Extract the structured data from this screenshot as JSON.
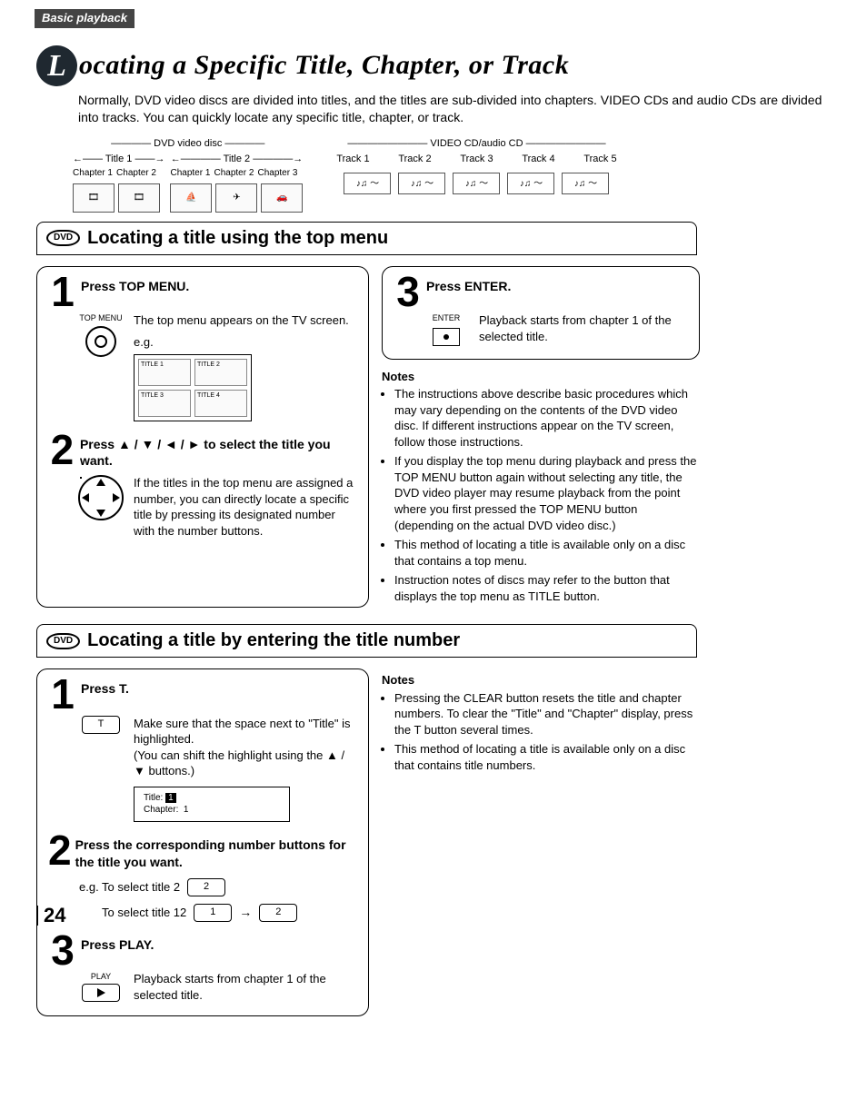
{
  "breadcrumb": "Basic playback",
  "page_number": "24",
  "main_title_prefix": "L",
  "main_title_rest": "ocating a Specific Title, Chapter, or Track",
  "intro": "Normally, DVD video discs are divided into titles, and the titles are sub-divided into chapters. VIDEO CDs and audio CDs are divided into tracks. You can quickly locate any specific title, chapter, or track.",
  "dvd_diagram": {
    "top": "DVD video disc",
    "titles": [
      "Title 1",
      "Title 2"
    ],
    "chapters_t1": [
      "Chapter 1",
      "Chapter 2"
    ],
    "chapters_t2": [
      "Chapter 1",
      "Chapter 2",
      "Chapter 3"
    ]
  },
  "cd_diagram": {
    "top": "VIDEO CD/audio CD",
    "tracks": [
      "Track 1",
      "Track 2",
      "Track 3",
      "Track 4",
      "Track 5"
    ],
    "track_glyph": "♪♫ ～"
  },
  "sec1_badge": "DVD",
  "sec1_title": "Locating a title using the top menu",
  "sec1": {
    "step1_title": "Press TOP MENU.",
    "step1_icon": "TOP MENU",
    "step1_text": "The top menu appears on the TV screen.",
    "step1_eg": "e.g.",
    "tiles": [
      "TITLE 1",
      "TITLE 2",
      "TITLE 3",
      "TITLE 4"
    ],
    "step2_title": "Press ▲ / ▼ / ◄ / ► to select the title you want.",
    "step2_text": "If the titles in the top menu are assigned a number, you can directly locate a specific title by pressing its designated number with the number buttons.",
    "step3_title": "Press ENTER.",
    "step3_icon": "ENTER",
    "step3_text": "Playback starts from chapter 1 of the selected title.",
    "notes_h": "Notes",
    "notes": [
      "The instructions above describe basic procedures which may vary depending on the contents of the DVD video disc. If different instructions appear on the TV screen, follow those instructions.",
      "If you display the top menu during playback and press the TOP MENU button again without selecting any title, the DVD video player may resume playback from the point where you first pressed the TOP MENU button (depending on the actual DVD video disc.)",
      "This method of locating a title is available only on a disc that contains a top menu.",
      "Instruction notes of discs may refer to the button that displays the top menu as TITLE button."
    ]
  },
  "sec2_badge": "DVD",
  "sec2_title": "Locating a title by entering the title number",
  "sec2": {
    "step1_title": "Press T.",
    "step1_key": "T",
    "step1_text": "Make sure that the space next to \"Title\" is highlighted.\n(You can shift the highlight using the ▲ / ▼ buttons.)",
    "screen_title": "Title:",
    "screen_title_val": "1",
    "screen_chapter": "Chapter:",
    "screen_chapter_val": "1",
    "step2_title": "Press the corresponding number buttons for the title you want.",
    "eg_a": "e.g. To select title 2",
    "eg_a_key": "2",
    "eg_b": "       To select title 12",
    "eg_b_key1": "1",
    "eg_b_key2": "2",
    "step3_title": "Press PLAY.",
    "step3_label": "PLAY",
    "step3_text": "Playback starts from chapter 1 of the selected title.",
    "notes_h": "Notes",
    "notes": [
      "Pressing the CLEAR button resets the title and chapter numbers. To clear the \"Title\" and \"Chapter\" display, press the T button several times.",
      "This method of locating a title is available only on a disc that contains title numbers."
    ]
  }
}
